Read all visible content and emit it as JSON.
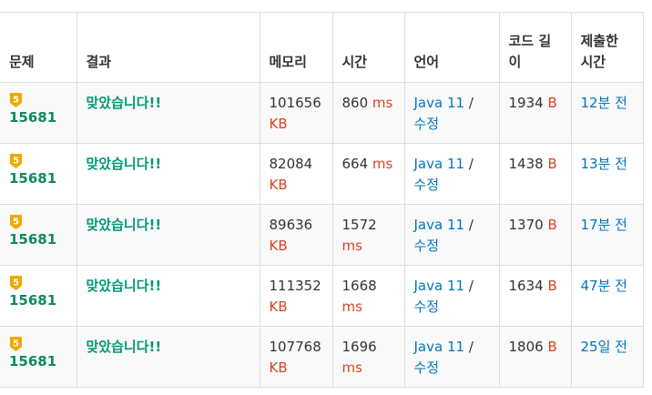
{
  "columns": {
    "problem": "문제",
    "result": "결과",
    "memory": "메모리",
    "time": "시간",
    "language": "언어",
    "code_length": "코드 길이",
    "submitted": "제출한 시간"
  },
  "colors": {
    "accepted": "#009874",
    "unit": "#dd4124",
    "link": "#0076c0",
    "badge": "#f0a800"
  },
  "rows": [
    {
      "tier": "5",
      "problem_id": "15681",
      "result": "맞았습니다!!",
      "memory": "101656",
      "memory_unit": "KB",
      "time": "860",
      "time_unit": "ms",
      "language": "Java 11",
      "edit": "수정",
      "code_length": "1934",
      "code_unit": "B",
      "submitted": "12분 전"
    },
    {
      "tier": "5",
      "problem_id": "15681",
      "result": "맞았습니다!!",
      "memory": "82084",
      "memory_unit": "KB",
      "time": "664",
      "time_unit": "ms",
      "language": "Java 11",
      "edit": "수정",
      "code_length": "1438",
      "code_unit": "B",
      "submitted": "13분 전"
    },
    {
      "tier": "5",
      "problem_id": "15681",
      "result": "맞았습니다!!",
      "memory": "89636",
      "memory_unit": "KB",
      "time": "1572",
      "time_unit": "ms",
      "language": "Java 11",
      "edit": "수정",
      "code_length": "1370",
      "code_unit": "B",
      "submitted": "17분 전"
    },
    {
      "tier": "5",
      "problem_id": "15681",
      "result": "맞았습니다!!",
      "memory": "111352",
      "memory_unit": "KB",
      "time": "1668",
      "time_unit": "ms",
      "language": "Java 11",
      "edit": "수정",
      "code_length": "1634",
      "code_unit": "B",
      "submitted": "47분 전"
    },
    {
      "tier": "5",
      "problem_id": "15681",
      "result": "맞았습니다!!",
      "memory": "107768",
      "memory_unit": "KB",
      "time": "1696",
      "time_unit": "ms",
      "language": "Java 11",
      "edit": "수정",
      "code_length": "1806",
      "code_unit": "B",
      "submitted": "25일 전"
    }
  ]
}
